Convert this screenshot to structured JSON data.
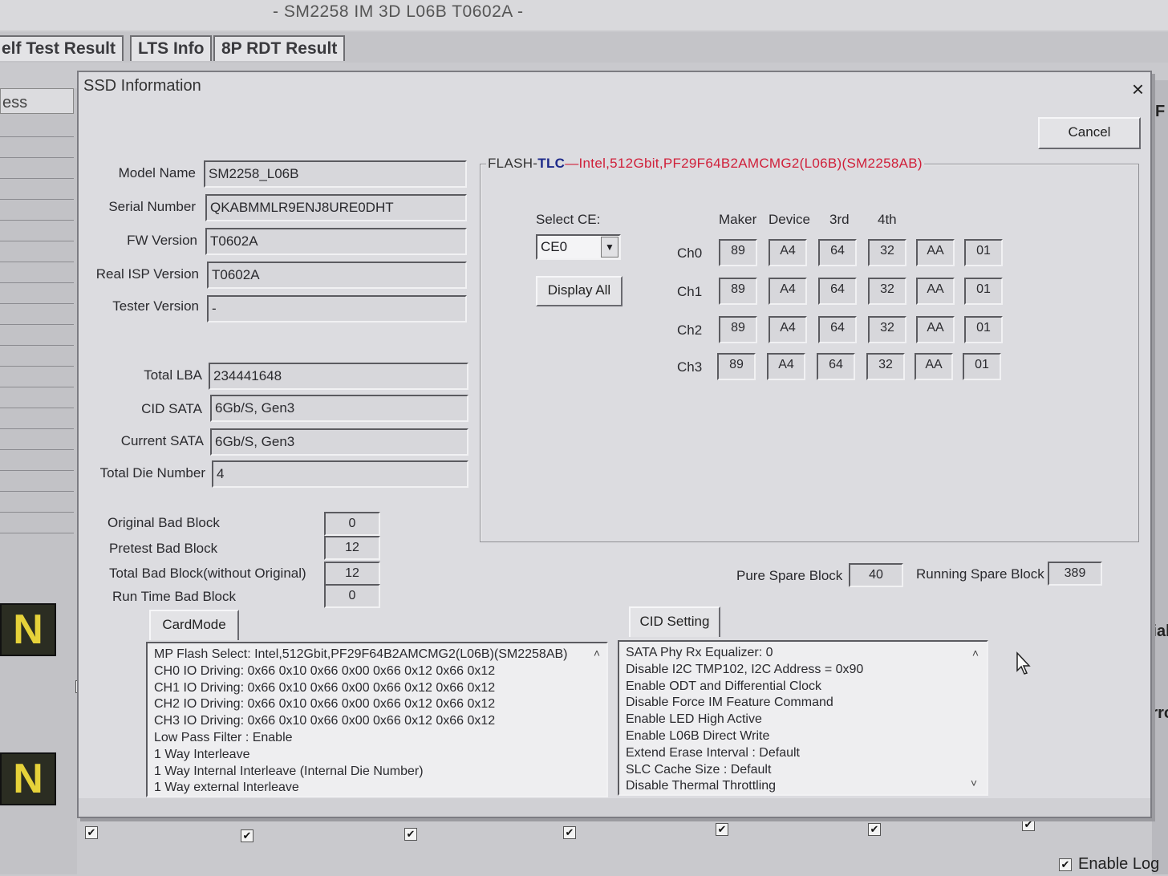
{
  "app": {
    "title": "- SM2258 IM 3D L06B T0602A -",
    "tabs": [
      "elf Test Result",
      "LTS Info",
      "8P RDT Result"
    ],
    "left_column_header": "ess",
    "badge_letter": "N",
    "right_labels": [
      "F",
      "nitial",
      "Erro"
    ],
    "bottom_right_label": "Enable Log"
  },
  "dialog": {
    "title": "SSD Information",
    "close_symbol": "×",
    "cancel_label": "Cancel",
    "info": [
      {
        "label": "Model Name",
        "value": "SM2258_L06B"
      },
      {
        "label": "Serial Number",
        "value": "QKABMMLR9ENJ8URE0DHT"
      },
      {
        "label": "FW Version",
        "value": "T0602A"
      },
      {
        "label": "Real ISP Version",
        "value": "T0602A"
      },
      {
        "label": "Tester Version",
        "value": "-"
      },
      {
        "label": "Total LBA",
        "value": "234441648"
      },
      {
        "label": "CID SATA",
        "value": "6Gb/S, Gen3"
      },
      {
        "label": "Current SATA",
        "value": "6Gb/S, Gen3"
      },
      {
        "label": "Total Die Number",
        "value": "4"
      }
    ],
    "bad_blocks": [
      {
        "label": "Original Bad Block",
        "value": "0"
      },
      {
        "label": "Pretest Bad Block",
        "value": "12"
      },
      {
        "label": "Total Bad Block(without Original)",
        "value": "12"
      },
      {
        "label": "Run Time Bad Block",
        "value": "0"
      }
    ],
    "flash": {
      "prefix": "FLASH-",
      "type": "TLC",
      "desc": "—Intel,512Gbit,PF29F64B2AMCMG2(L06B)(SM2258AB)",
      "select_ce_label": "Select CE:",
      "select_ce_value": "CE0",
      "display_all_label": "Display All",
      "columns": [
        "Maker",
        "Device",
        "3rd",
        "4th"
      ],
      "channels": [
        {
          "label": "Ch0",
          "ids": [
            "89",
            "A4",
            "64",
            "32",
            "AA",
            "01"
          ]
        },
        {
          "label": "Ch1",
          "ids": [
            "89",
            "A4",
            "64",
            "32",
            "AA",
            "01"
          ]
        },
        {
          "label": "Ch2",
          "ids": [
            "89",
            "A4",
            "64",
            "32",
            "AA",
            "01"
          ]
        },
        {
          "label": "Ch3",
          "ids": [
            "89",
            "A4",
            "64",
            "32",
            "AA",
            "01"
          ]
        }
      ],
      "pure_spare_label": "Pure Spare Block",
      "pure_spare_value": "40",
      "running_spare_label": "Running Spare Block",
      "running_spare_value": "389"
    },
    "cardmode": {
      "tab_label": "CardMode",
      "lines": [
        "MP Flash Select: Intel,512Gbit,PF29F64B2AMCMG2(L06B)(SM2258AB)",
        "CH0 IO Driving: 0x66 0x10 0x66 0x00 0x66 0x12 0x66 0x12",
        "CH1 IO Driving: 0x66 0x10 0x66 0x00 0x66 0x12 0x66 0x12",
        "CH2 IO Driving: 0x66 0x10 0x66 0x00 0x66 0x12 0x66 0x12",
        "CH3 IO Driving: 0x66 0x10 0x66 0x00 0x66 0x12 0x66 0x12",
        "Low Pass Filter : Enable",
        "1 Way Interleave",
        "1 Way Internal Interleave (Internal Die Number)",
        "1 Way external Interleave"
      ]
    },
    "cid": {
      "tab_label": "CID Setting",
      "lines": [
        "SATA Phy Rx Equalizer: 0",
        "Disable I2C TMP102, I2C Address = 0x90",
        "Enable ODT and Differential Clock",
        "Disable Force IM Feature Command",
        "Enable LED High Active",
        "Enable L06B Direct Write",
        "Extend Erase Interval : Default",
        "SLC Cache Size : Default",
        "Disable Thermal Throttling"
      ]
    },
    "check_mark": "✔",
    "scroll_up": "˄",
    "scroll_down": "˅",
    "dropdown_arrow": "▼"
  }
}
